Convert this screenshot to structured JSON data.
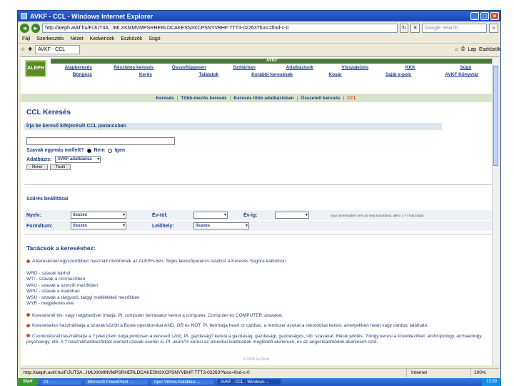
{
  "window": {
    "title": "AVKF - CCL - Windows Internet Explorer",
    "address": "http://aleph.avkf.hu/F/JUT3A...IMLXKMMVMPSRHERLDCAKESN3XCPSNYVBHF:TTT3-02263?func=find-c-0",
    "search_placeholder": "Google Search",
    "menu": [
      "Fájl",
      "Szerkesztés",
      "Nézet",
      "Kedvencek",
      "Eszközök",
      "Súgó"
    ],
    "tab_label": "AVKF - CCL",
    "tools": [
      "Lap",
      "Eszközök"
    ]
  },
  "site": {
    "logo_text": "ALEPH",
    "band_text": "AVKF",
    "nav_row1": [
      "Alapkeresés",
      "Részletes keresés",
      "Összefűggesen",
      "Szótárban",
      "Adatbázisok",
      "Visszajelzés",
      "KKK",
      "Súgó"
    ],
    "nav_row2": [
      "Böngész",
      "Kerés",
      "Találatok",
      "Korábbi keresések",
      "Kosár",
      "Saját e-polc",
      "AVKF Könyvtár"
    ],
    "subnav": [
      "Keresés",
      "Több-mezős keresés",
      "Keresés több adatbázisban",
      "Összetett keresés",
      "CCL"
    ],
    "subnav_active": "CCL"
  },
  "form": {
    "page_title": "CCL Keresés",
    "input_label": "Írja be kereső kifejezését CCL parancsban",
    "input_value": "",
    "words_label": "Szavak egymás mellett?",
    "radio_yes": "Nem",
    "radio_no": "Igen",
    "db_label": "Adatbázis:",
    "db_value": "AVKF adatbázisa",
    "ok_label": "Mehet",
    "clear_label": "Tisztít"
  },
  "filters": {
    "title": "Szűrés beállításai",
    "lang_label": "Nyelv:",
    "lang_value": "összes",
    "year_from_label": "Év-tól:",
    "year_to_label": "Év-ig:",
    "year_hint": "yyyy (amennyiben nem ad meg tartományt, akkor a ?-t használja)",
    "format_label": "Formátum:",
    "format_value": "összes",
    "location_label": "Lelőhely:",
    "location_value": "összes"
  },
  "tips": {
    "title": "Tanácsok a kereséshez:",
    "p1": "A keresésnél egyszerűbben használt rövidítések az ALEPH-ben. Teljes keresőparancs listához a Keresés Súgóra kattintson.",
    "abbrevs": [
      "WRD - szavak bárhol",
      "WTI - szavak a címmezőben",
      "WAU - szavak a szerzői mezőkben",
      "WPU - szavak a kiadóban",
      "WSU - szavak a tárgyszó, tárgyi melléktételi mezőkben",
      "WYR - megjelenés éve"
    ],
    "p2": "Keresésnél kis- vagy nagybetűvel írhatja. Pl. computer beírásakor keresi a computer, Computer és COMPUTER szavakat.",
    "p3": "Keresésekor használhatja a szavak között a Boole operátorokat AND, OR és NOT. Pl. beírhatja heart or cardiac, a rendszer azokat a rekordokat keresi, amelyekben heart vagy cardiac található.",
    "p4": "Csonkolásnál használhatja a ? jelet (nem tudja pontosan a keresett szót). Pl. gazdaság? keresi a gazdaság, gazdasági, gazdaságos, stb. szavakat. Másik jelölés, ?ology keresi a következőket: anthropology, archaeology, psychology, stb. A ? használhatókeződnél kiemelt szavak esetén is. Pl. alumi?n keresi az amerikai kiadmódok megfelelő aluminum, és az angol kiadmódok aluminium szót.",
    "footer": "© 2004 Ex Libris"
  },
  "status": {
    "url": "http://aleph.avkf.hu/F/JUT3A...IMLXKMMVMPSRHERLDCAKESN3XCPSNYVBHF:TTT3-02263?func=find-c-0",
    "zone": "Internet",
    "zoom": "100%"
  },
  "taskbar": {
    "start": "Start",
    "items": [
      "01",
      "Microsoft PowerPoint ...",
      "Apor Vilmos Katolikus ...",
      "AVKF - CCL - Windows ..."
    ],
    "active": "AVKF - CCL - Windows ...",
    "clock": "13:39"
  }
}
